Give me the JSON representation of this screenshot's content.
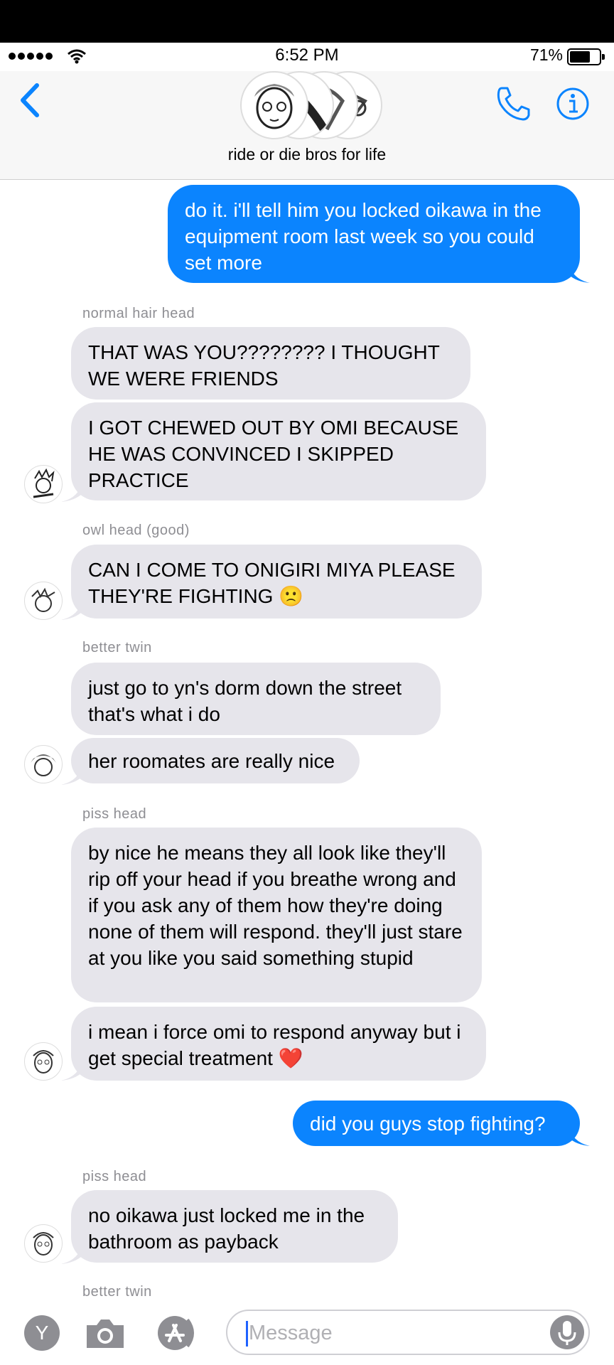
{
  "status_bar": {
    "time": "6:52 PM",
    "battery": "71%",
    "battery_level": 0.71
  },
  "header": {
    "group_name": "ride or die bros for life",
    "back_icon": "chevron-left-icon",
    "call_icon": "phone-icon",
    "info_icon": "info-icon"
  },
  "messages": [
    {
      "side": "out",
      "text": "do it. i'll tell him you locked oikawa in the equipment room last week so you could set more"
    },
    {
      "side": "in",
      "sender": "normal hair head",
      "text": "THAT WAS YOU???????? I THOUGHT WE WERE FRIENDS"
    },
    {
      "side": "in",
      "text": "I GOT CHEWED OUT BY OMI BECAUSE HE WAS CONVINCED I SKIPPED PRACTICE"
    },
    {
      "side": "in",
      "sender": "owl head (good)",
      "text": "CAN I COME TO ONIGIRI MIYA PLEASE THEY'RE FIGHTING",
      "emoji": "🙁"
    },
    {
      "side": "in",
      "sender": "better twin",
      "text": "just go to yn's dorm down the street that's what i do"
    },
    {
      "side": "in",
      "text": "her roomates are really nice"
    },
    {
      "side": "in",
      "sender": "piss head",
      "text": "by nice he means they all look like they'll rip off your head if you breathe wrong and if you ask any of them how they're doing none of them will respond. they'll just stare at you like you said something stupid"
    },
    {
      "side": "in",
      "text": "i mean i force omi to respond anyway but i get special treatment",
      "emoji": "❤️"
    },
    {
      "side": "out",
      "text": "did you guys stop fighting?"
    },
    {
      "side": "in",
      "sender": "piss head",
      "text": "no oikawa just locked me in the bathroom as payback"
    },
    {
      "side": "in",
      "sender": "better twin",
      "text": ""
    }
  ],
  "input_bar": {
    "app_button_letter": "Y",
    "camera_icon": "camera-icon",
    "appstore_icon": "app-store-icon",
    "placeholder": "Message",
    "mic_icon": "microphone-icon"
  },
  "colors": {
    "accent": "#0b84fe",
    "incoming_bubble": "#e6e5eb",
    "sender_label": "#8e8e93"
  }
}
